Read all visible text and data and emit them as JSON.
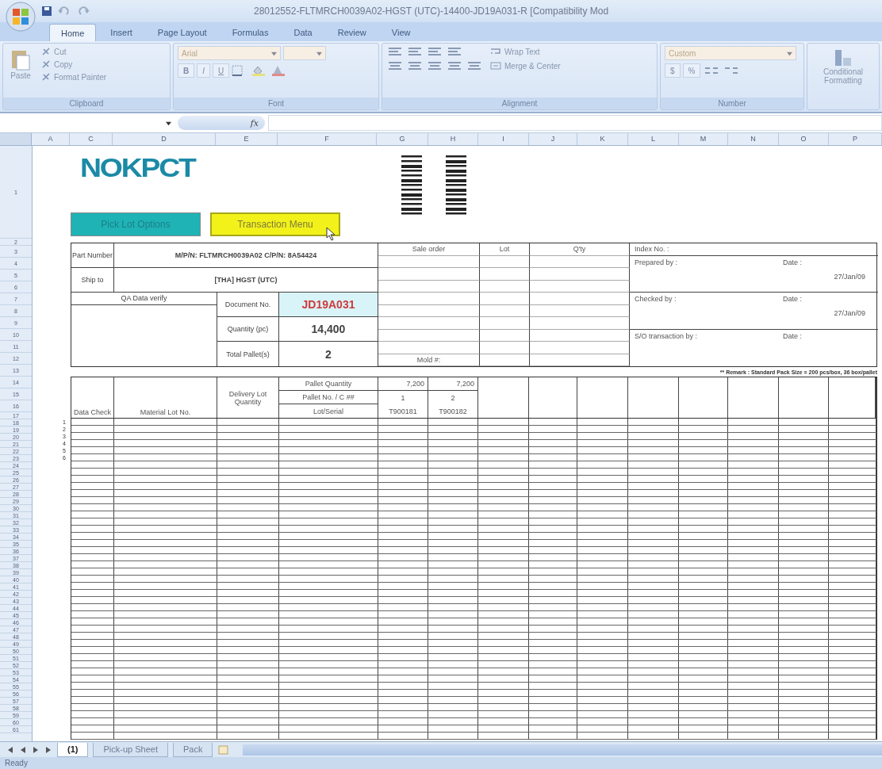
{
  "title_bar": {
    "title": "28012552-FLTMRCH0039A02-HGST (UTC)-14400-JD19A031-R  [Compatibility Mod"
  },
  "ribbon_tabs": [
    {
      "label": "Home",
      "selected": true
    },
    {
      "label": "Insert",
      "selected": false
    },
    {
      "label": "Page Layout",
      "selected": false
    },
    {
      "label": "Formulas",
      "selected": false
    },
    {
      "label": "Data",
      "selected": false
    },
    {
      "label": "Review",
      "selected": false
    },
    {
      "label": "View",
      "selected": false
    }
  ],
  "ribbon": {
    "clipboard": {
      "label": "Clipboard",
      "paste": "Paste",
      "items": [
        "Cut",
        "Copy",
        "Format Painter"
      ]
    },
    "font": {
      "label": "Font",
      "family": "Arial",
      "buttons": [
        "B",
        "I",
        "U"
      ]
    },
    "alignment": {
      "label": "Alignment",
      "wrap": "Wrap Text",
      "merge": "Merge & Center"
    },
    "number": {
      "label": "Number",
      "format": "Custom",
      "symbols": [
        "$",
        "%"
      ]
    },
    "styles": {
      "conditional": "Conditional Formatting"
    }
  },
  "formula_bar": {
    "function_label": "fx"
  },
  "column_headers": [
    "A",
    "C",
    "D",
    "E",
    "F",
    "G",
    "H",
    "I",
    "J",
    "K",
    "L",
    "M",
    "N",
    "O",
    "P"
  ],
  "row_headers": [
    "1",
    "2",
    "3",
    "4",
    "5",
    "6",
    "7",
    "8",
    "9",
    "10",
    "11",
    "12",
    "13",
    "14",
    "15",
    "16",
    "17",
    "18",
    "19",
    "20",
    "21",
    "22",
    "23",
    "24",
    "25",
    "26",
    "27",
    "28",
    "29",
    "30",
    "31",
    "32",
    "33",
    "34",
    "35",
    "36",
    "37",
    "38",
    "39",
    "40",
    "41",
    "42",
    "43",
    "44",
    "45",
    "46",
    "47",
    "48",
    "49",
    "50",
    "51",
    "52",
    "53",
    "54",
    "55",
    "56",
    "57",
    "58",
    "59",
    "60",
    "61"
  ],
  "sheet": {
    "logo": "NOKPCT",
    "buttons": [
      {
        "label": "Pick Lot Options",
        "kind": "teal"
      },
      {
        "label": "Transaction Menu",
        "kind": "yellow"
      }
    ],
    "form": {
      "part_label": "Part Number",
      "part_value": "M/P/N: FLTMRCH0039A02 C/P/N: 8A54424",
      "ship_label": "Ship to",
      "ship_value": "[THA] HGST (UTC)",
      "qa_label": "QA Data verify",
      "document_label": "Document No.",
      "document_value": "JD19A031",
      "quantity_label": "Quantity (pc)",
      "quantity_value": "14,400",
      "pallets_label": "Total Pallet(s)",
      "pallets_value": "2",
      "middle_headers": [
        "Sale order",
        "Lot",
        "Q'ty"
      ],
      "mold_label": "Mold #:",
      "index_label": "Index No. :",
      "signoffs": [
        {
          "label": "Prepared by :",
          "date_label": "Date :",
          "date": "27/Jan/09"
        },
        {
          "label": "Checked by :",
          "date_label": "Date :",
          "date": "27/Jan/09"
        },
        {
          "label": "S/O transaction by :",
          "date_label": "Date :"
        }
      ]
    },
    "remark": "** Remark : Standard Pack Size = 200 pcs/box, 36 box/pallet",
    "lot_table": {
      "data_check": "Data Check",
      "material_lot": "Material Lot No.",
      "delivery": "Delivery Lot Quantity",
      "pallet_quantity": "Pallet Quantity",
      "pallet_no": "Pallet No. / C ##",
      "lot_serial": "Lot/Serial",
      "pallets": [
        {
          "quantity": "7,200",
          "number": "1",
          "serial": "T900181"
        },
        {
          "quantity": "7,200",
          "number": "2",
          "serial": "T900182"
        }
      ],
      "row_numbers": [
        "1",
        "2",
        "3",
        "4",
        "5",
        "6"
      ]
    }
  },
  "sheet_tabs": [
    {
      "label": "(1)",
      "selected": true
    },
    {
      "label": "Pick-up Sheet",
      "selected": false
    },
    {
      "label": "Pack",
      "selected": false
    }
  ],
  "status_bar": {
    "text": "Ready"
  }
}
